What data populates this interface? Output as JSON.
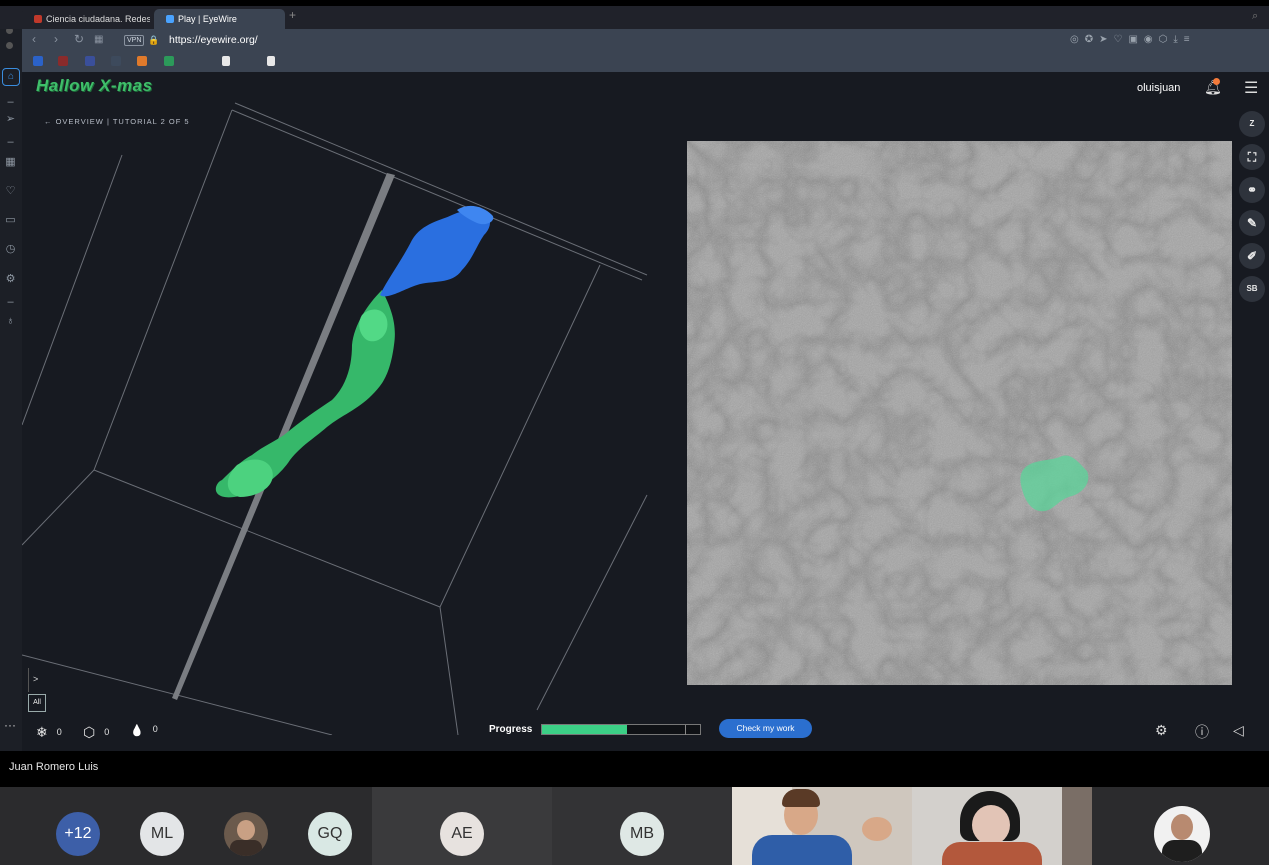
{
  "browser": {
    "tabs": [
      {
        "label": "Ciencia ciudadana. Redes y pro",
        "active": false
      },
      {
        "label": "Play | EyeWire",
        "active": true
      }
    ],
    "new_tab": "+",
    "url": "https://eyewire.org/",
    "vpn_label": "VPN"
  },
  "game": {
    "title": "Hallow X-mas",
    "breadcrumb": "← OVERVIEW | TUTORIAL 2 OF 5",
    "username": "oluisjuan",
    "right_tools": [
      {
        "label": "Z",
        "name": "zoom-button"
      },
      {
        "label": "⛶",
        "name": "fullscreen-button"
      },
      {
        "label": "⚭",
        "name": "binoculars-button"
      },
      {
        "label": "✎",
        "name": "pencil-button"
      },
      {
        "label": "✐",
        "name": "eraser-button"
      },
      {
        "label": "SB",
        "name": "sb-button"
      }
    ],
    "toggle_caret": ">",
    "all_button": "All",
    "stats": [
      {
        "icon": "snowflake-icon",
        "glyph": "❄",
        "value": "0"
      },
      {
        "icon": "cube-icon",
        "glyph": "⬡",
        "value": "0"
      },
      {
        "icon": "drop-icon",
        "glyph": "💧",
        "value": "0"
      }
    ],
    "progress_label": "Progress",
    "progress_fraction": 0.54,
    "check_button": "Check my work",
    "segment_colors": {
      "selected": "#3fcf86",
      "seed": "#2a6fe0"
    }
  },
  "meeting": {
    "speaker_name": "Juan Romero Luis",
    "participants": [
      {
        "initials": "+12",
        "color": "#3d5fa8",
        "text_color": "#ffffff"
      },
      {
        "initials": "ML",
        "color": "#e3e5e7",
        "text_color": "#333333"
      },
      {
        "initials": "GQ",
        "color": "#d9e8e4",
        "text_color": "#333333"
      },
      {
        "initials": "AE",
        "color": "#e7e2df",
        "text_color": "#333333"
      },
      {
        "initials": "MB",
        "color": "#dfe8e5",
        "text_color": "#333333"
      }
    ]
  }
}
